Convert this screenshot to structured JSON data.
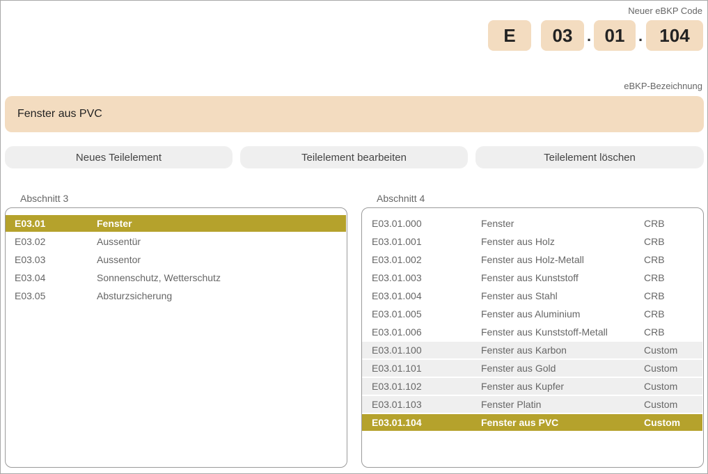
{
  "code": {
    "label": "Neuer eBKP Code",
    "parts": [
      "E",
      "03",
      "01",
      "104"
    ],
    "separator": "."
  },
  "bezeichnung": {
    "label": "eBKP-Bezeichnung",
    "value": "Fenster aus PVC"
  },
  "buttons": {
    "new": "Neues Teilelement",
    "edit": "Teilelement bearbeiten",
    "delete": "Teilelement löschen"
  },
  "colors": {
    "accent": "#b5a22c",
    "field_bg": "#f3dcc0",
    "button_bg": "#efefef"
  },
  "section3": {
    "label": "Abschnitt 3",
    "rows": [
      {
        "code": "E03.01",
        "name": "Fenster",
        "selected": true
      },
      {
        "code": "E03.02",
        "name": "Aussentür"
      },
      {
        "code": "E03.03",
        "name": "Aussentor"
      },
      {
        "code": "E03.04",
        "name": "Sonnenschutz, Wetterschutz"
      },
      {
        "code": "E03.05",
        "name": "Absturzsicherung"
      }
    ]
  },
  "section4": {
    "label": "Abschnitt 4",
    "rows": [
      {
        "code": "E03.01.000",
        "name": "Fenster",
        "source": "CRB"
      },
      {
        "code": "E03.01.001",
        "name": "Fenster aus Holz",
        "source": "CRB"
      },
      {
        "code": "E03.01.002",
        "name": "Fenster aus Holz-Metall",
        "source": "CRB"
      },
      {
        "code": "E03.01.003",
        "name": "Fenster aus Kunststoff",
        "source": "CRB"
      },
      {
        "code": "E03.01.004",
        "name": "Fenster aus Stahl",
        "source": "CRB"
      },
      {
        "code": "E03.01.005",
        "name": "Fenster aus Aluminium",
        "source": "CRB"
      },
      {
        "code": "E03.01.006",
        "name": "Fenster aus Kunststoff-Metall",
        "source": "CRB"
      },
      {
        "code": "E03.01.100",
        "name": "Fenster aus Karbon",
        "source": "Custom",
        "custom": true
      },
      {
        "code": "E03.01.101",
        "name": "Fenster aus Gold",
        "source": "Custom",
        "custom": true
      },
      {
        "code": "E03.01.102",
        "name": "Fenster aus Kupfer",
        "source": "Custom",
        "custom": true
      },
      {
        "code": "E03.01.103",
        "name": "Fenster Platin",
        "source": "Custom",
        "custom": true
      },
      {
        "code": "E03.01.104",
        "name": "Fenster aus PVC",
        "source": "Custom",
        "custom": true,
        "selected": true
      }
    ]
  }
}
